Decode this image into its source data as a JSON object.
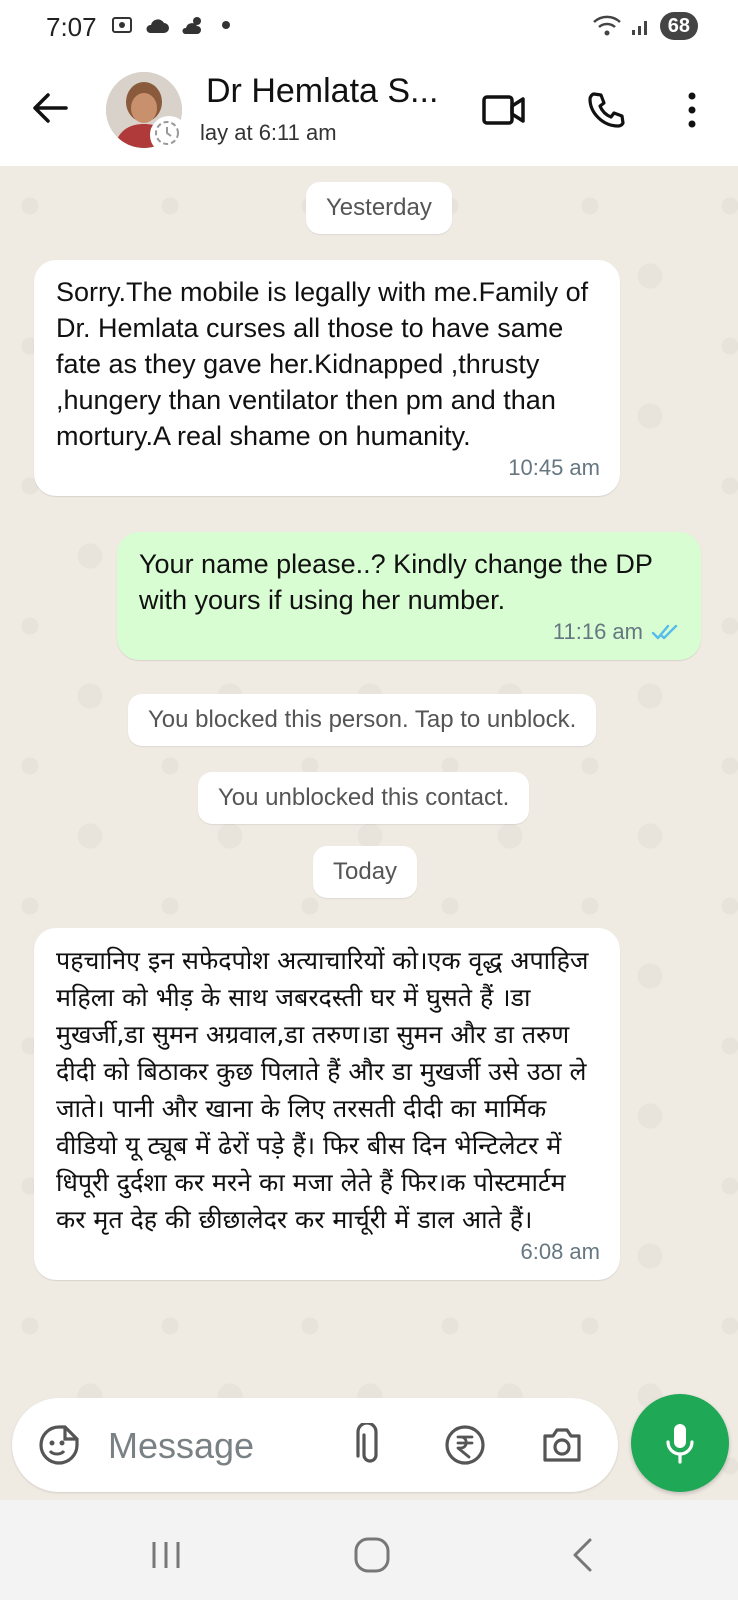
{
  "status_bar": {
    "time": "7:07",
    "battery": "68"
  },
  "header": {
    "contact_name": "Dr Hemlata S...",
    "last_seen": "lay at 6:11 am",
    "icons": [
      "back-arrow-icon",
      "video-call-icon",
      "voice-call-icon",
      "more-options-icon"
    ]
  },
  "chat": {
    "date_yesterday": "Yesterday",
    "msg1": {
      "text": "Sorry.The mobile is legally with me.Family of Dr. Hemlata curses all those to have same fate as they gave her.Kidnapped ,thrusty ,hungery than ventilator then pm and than mortury.A real shame on humanity.",
      "time": "10:45 am"
    },
    "msg2": {
      "text": "Your name please..? Kindly change the DP with yours if using her number.",
      "time": "11:16 am",
      "status": "read"
    },
    "system1": "You blocked this person. Tap to unblock.",
    "system2": "You unblocked this contact.",
    "date_today": "Today",
    "msg3": {
      "text": "पहचानिए इन सफेदपोश अत्याचारियों को।एक वृद्ध अपाहिज महिला को भीड़ के साथ जबरदस्ती घर में घुसते हैं ।डा मुखर्जी,डा सुमन अग्रवाल,डा तरुण।डा सुमन और डा तरुण दीदी को बिठाकर कुछ पिलाते हैं और डा मुखर्जी उसे उठा ले जाते। पानी और खाना के लिए  तरसती दीदी का मार्मिक वीडियो यू ट्यूब में ढेरों पड़े हैं। फिर बीस दिन भेन्टिलेटर में धिपूरी दुर्दशा कर मरने का मजा लेते हैं फिर।क पोस्टमार्टम कर मृत देह की छीछालेदर कर मार्चूरी में  डाल आते हैं।",
      "time": "6:08 am"
    }
  },
  "composer": {
    "placeholder": "Message",
    "icons": [
      "emoji-sticker-icon",
      "attach-icon",
      "payment-rupee-icon",
      "camera-icon",
      "mic-icon"
    ]
  },
  "colors": {
    "chat_bg": "#efeae2",
    "outgoing_bubble": "#d9fdd3",
    "incoming_bubble": "#ffffff",
    "accent_green": "#1fa855",
    "read_tick": "#53bdeb"
  }
}
